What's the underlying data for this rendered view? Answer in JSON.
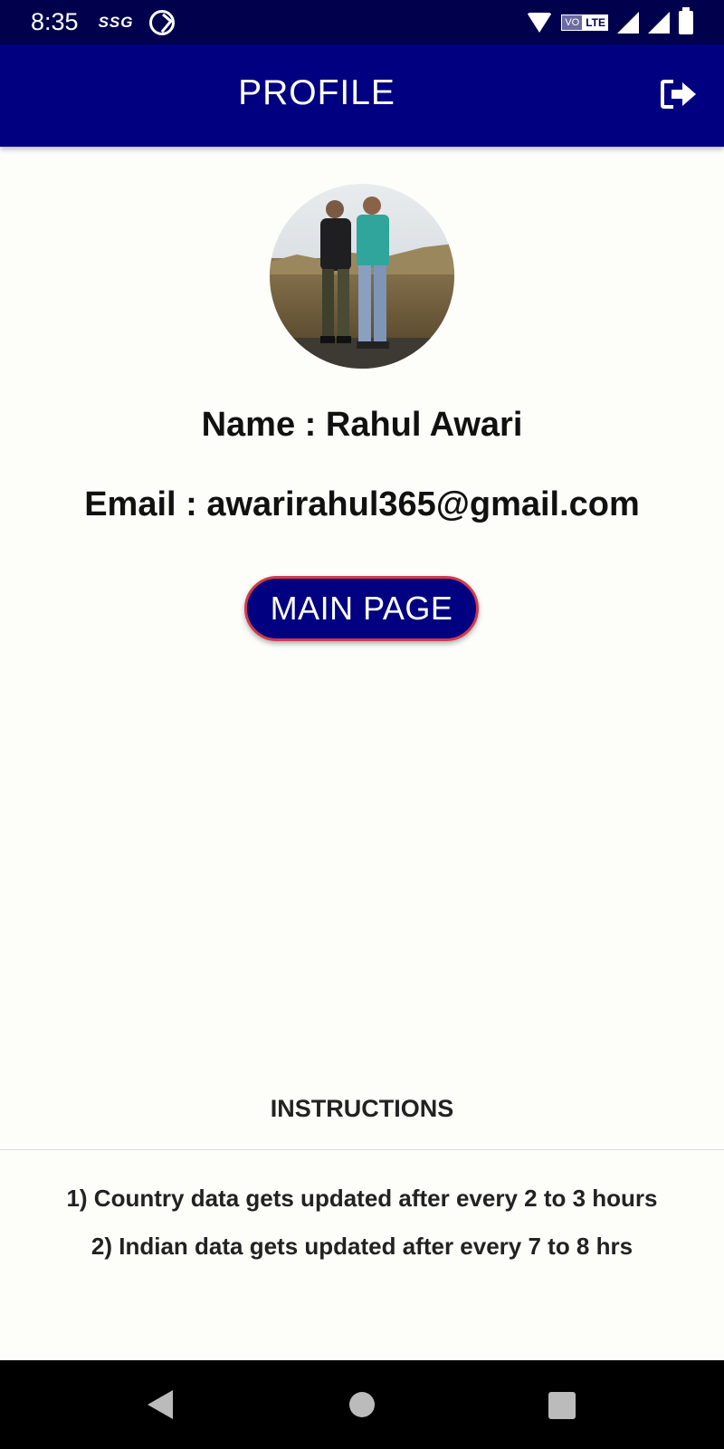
{
  "status_bar": {
    "time": "8:35",
    "carrier": "SSG",
    "volte": "VO",
    "network": "LTE"
  },
  "app_bar": {
    "title": "PROFILE"
  },
  "profile": {
    "name_text": "Name : Rahul Awari",
    "email_text": "Email : awarirahul365@gmail.com",
    "main_page_label": "MAIN PAGE"
  },
  "instructions": {
    "title": "INSTRUCTIONS",
    "items": [
      "1) Country data gets updated after every 2 to 3 hours",
      "2) Indian data gets updated after every 7 to 8 hrs"
    ]
  },
  "colors": {
    "app_bar": "#000080",
    "status_bar": "#00004d",
    "button_border": "#d33a4a",
    "background": "#fdfdfa"
  },
  "icons": {
    "logout": "logout-icon",
    "back": "back-icon",
    "home": "home-icon",
    "recents": "recents-icon"
  }
}
